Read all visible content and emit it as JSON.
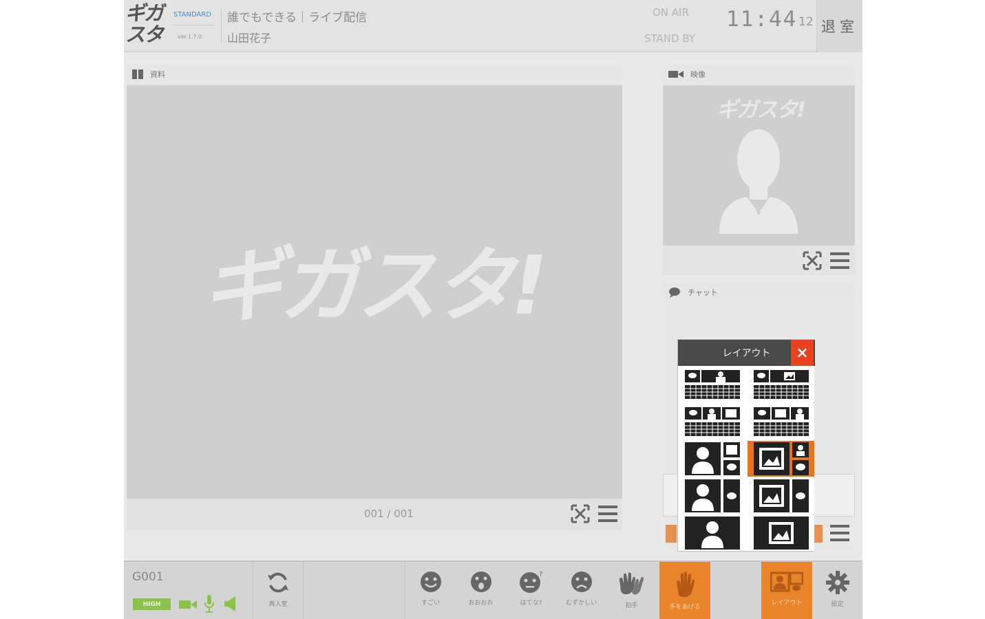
{
  "header": {
    "logo_line1": "ギガ",
    "logo_line2": "スタ",
    "plan": "STANDARD",
    "version": "ver.1.7.0",
    "event_title": "誰でもできる｜ライブ配信",
    "presenter": "山田花子",
    "status_on_air": "ON AIR",
    "status_standby": "STAND BY",
    "clock_time": "11:44",
    "clock_seconds": "12",
    "exit_label": "退室"
  },
  "material": {
    "title": "資料",
    "watermark": "ギガスタ!",
    "page_counter": "001 / 001"
  },
  "video": {
    "title": "映像",
    "watermark": "ギガスタ!"
  },
  "chat": {
    "title": "チャット"
  },
  "layout_popup": {
    "title": "レイアウト",
    "close_icon": "×",
    "selected_index": 5,
    "options": [
      "chat-video-grid",
      "chat-material-grid",
      "chat-video-material-grid",
      "chat-material-video-grid",
      "video-large-material-chat",
      "material-large-video-chat",
      "video-large-chat",
      "material-large-chat",
      "video-only",
      "material-only"
    ]
  },
  "toolbar": {
    "room_id": "G001",
    "quality": "HIGH",
    "buttons": [
      {
        "label": "再入室",
        "icon": "refresh-icon",
        "active": false
      },
      {
        "label": "すごい",
        "icon": "smile-icon",
        "active": false
      },
      {
        "label": "おおおお",
        "icon": "surprised-icon",
        "active": false
      },
      {
        "label": "はてな?",
        "icon": "question-icon",
        "active": false
      },
      {
        "label": "むずかしい",
        "icon": "sad-icon",
        "active": false
      },
      {
        "label": "拍手",
        "icon": "clap-icon",
        "active": false
      },
      {
        "label": "手をあげる",
        "icon": "hand-raise-icon",
        "active": true
      },
      {
        "label": "レイアウト",
        "icon": "layout-icon",
        "active": true
      },
      {
        "label": "設定",
        "icon": "gear-icon",
        "active": false
      }
    ]
  },
  "colors": {
    "accent": "#e8842a",
    "close": "#e8421e",
    "quality_green": "#8bc34a",
    "plan_blue": "#3e8ed0"
  }
}
